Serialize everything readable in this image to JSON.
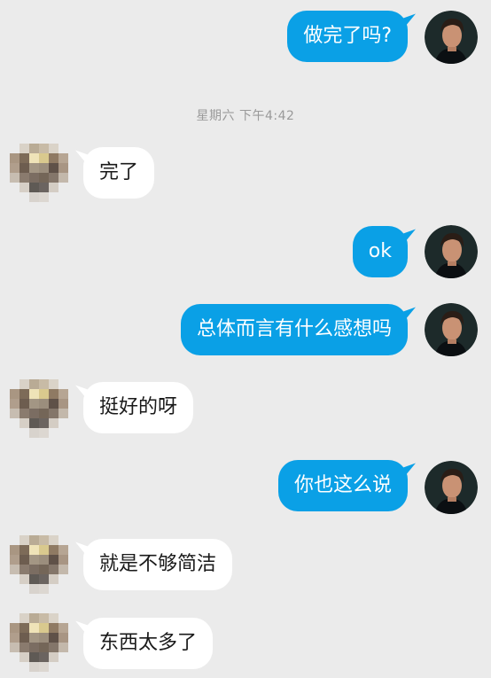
{
  "timestamp": "星期六 下午4:42",
  "messages": [
    {
      "direction": "out",
      "text": "做完了吗?"
    },
    {
      "direction": "in",
      "text": "完了"
    },
    {
      "direction": "out",
      "text": "ok"
    },
    {
      "direction": "out",
      "text": "总体而言有什么感想吗"
    },
    {
      "direction": "in",
      "text": "挺好的呀"
    },
    {
      "direction": "out",
      "text": "你也这么说"
    },
    {
      "direction": "in",
      "text": "就是不够简洁"
    },
    {
      "direction": "in",
      "text": "东西太多了"
    }
  ],
  "colors": {
    "background": "#ebebeb",
    "outgoing_bubble": "#0aa0e6",
    "incoming_bubble": "#ffffff"
  },
  "icons": {
    "self_avatar": "user-photo-avatar",
    "other_avatar": "pixelated-avatar"
  }
}
